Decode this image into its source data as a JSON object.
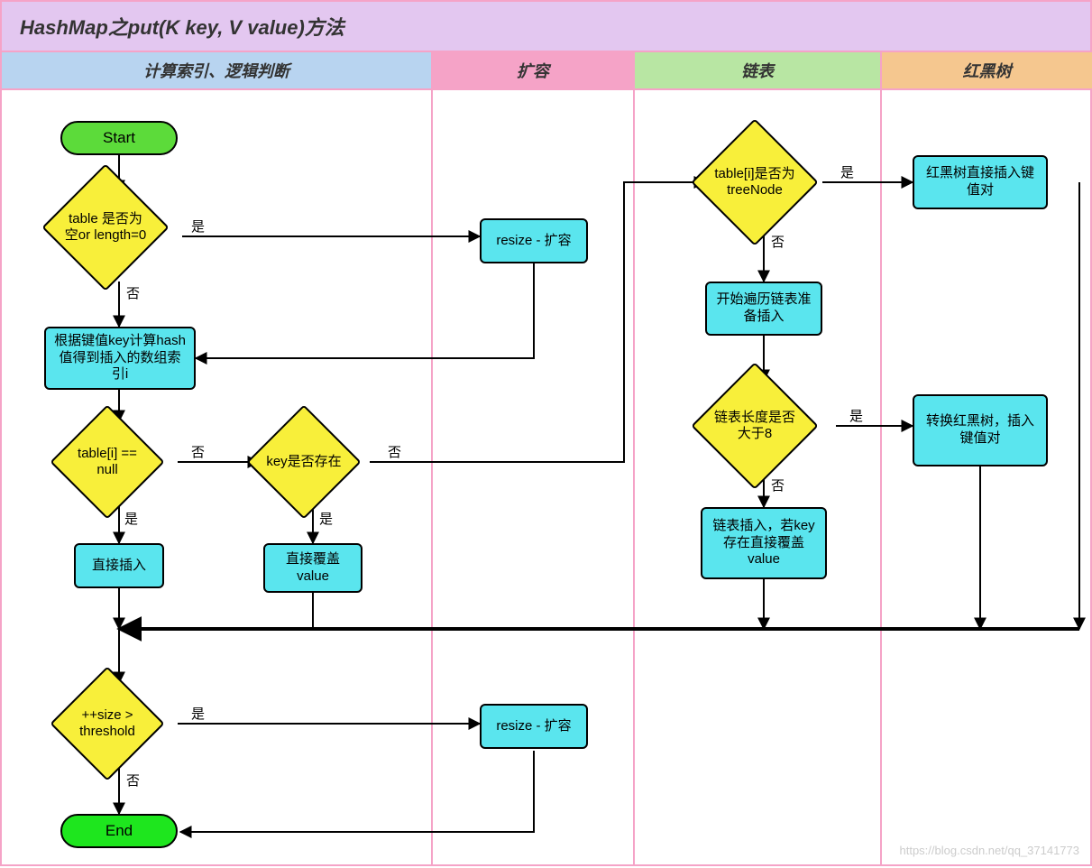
{
  "title": "HashMap之put(K key, V value)方法",
  "columns": [
    "计算索引、逻辑判断",
    "扩容",
    "链表",
    "红黑树"
  ],
  "nodes": {
    "start": "Start",
    "end": "End",
    "d_table_empty": "table 是否为空or length=0",
    "p_hash_index": "根据键值key计算hash值得到插入的数组索引i",
    "d_table_i_null": "table[i] == null",
    "d_key_exist": "key是否存在",
    "p_direct_insert": "直接插入",
    "p_direct_overwrite": "直接覆盖value",
    "d_size_threshold": "++size > threshold",
    "p_resize1": "resize - 扩容",
    "p_resize2": "resize - 扩容",
    "d_treenode": "table[i]是否为treeNode",
    "p_traverse_list": "开始遍历链表准备插入",
    "d_list_len_8": "链表长度是否大于8",
    "p_list_insert": "链表插入，若key存在直接覆盖value",
    "p_rbtree_insert": "红黑树直接插入键值对",
    "p_to_rbtree": "转换红黑树，插入键值对"
  },
  "labels": {
    "yes": "是",
    "no": "否"
  },
  "watermark": "https://blog.csdn.net/qq_37141773"
}
